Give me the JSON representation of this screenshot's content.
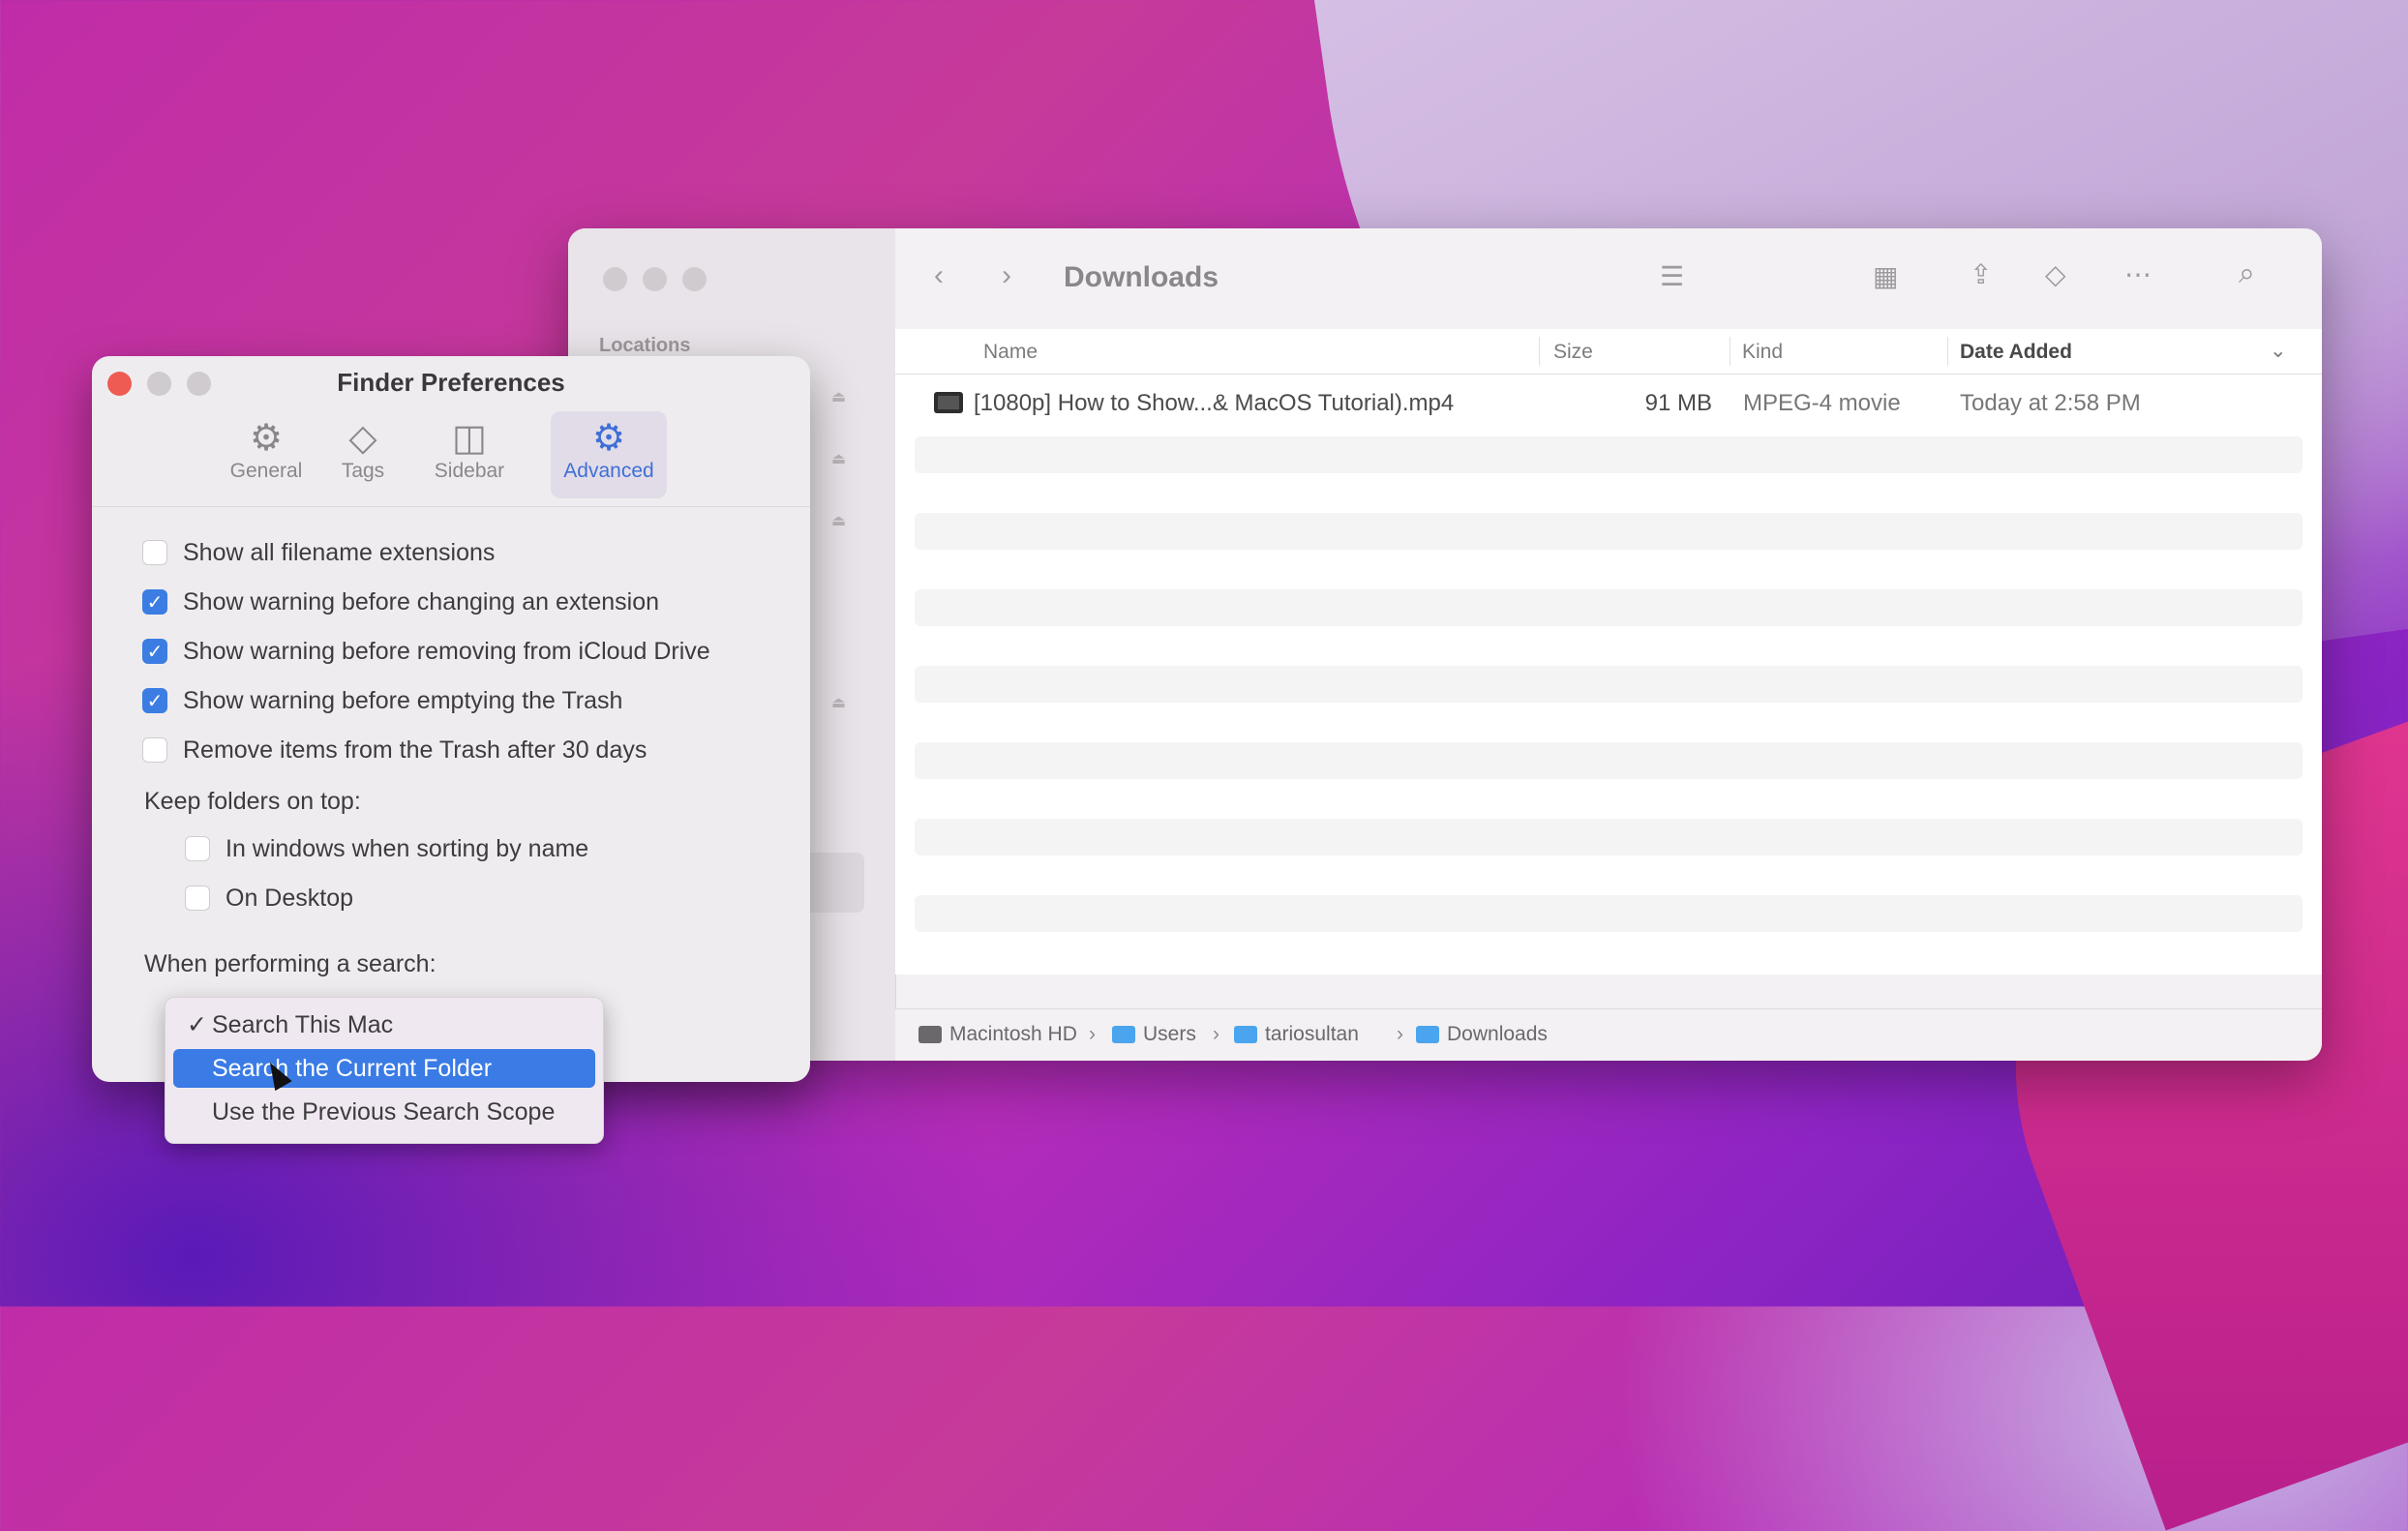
{
  "finder": {
    "title": "Downloads",
    "sidebar_heading": "Locations",
    "columns": {
      "name": "Name",
      "size": "Size",
      "kind": "Kind",
      "date": "Date Added"
    },
    "files": [
      {
        "name": "[1080p] How to Show...& MacOS Tutorial).mp4",
        "size": "91 MB",
        "kind": "MPEG-4 movie",
        "date": "Today at 2:58 PM"
      }
    ],
    "path": [
      "Macintosh HD",
      "Users",
      "tariosultan",
      "Downloads"
    ],
    "path_separator": "›"
  },
  "prefs": {
    "title": "Finder Preferences",
    "tabs": [
      "General",
      "Tags",
      "Sidebar",
      "Advanced"
    ],
    "active_tab": "Advanced",
    "options": [
      {
        "label": "Show all filename extensions",
        "checked": false
      },
      {
        "label": "Show warning before changing an extension",
        "checked": true
      },
      {
        "label": "Show warning before removing from iCloud Drive",
        "checked": true
      },
      {
        "label": "Show warning before emptying the Trash",
        "checked": true
      },
      {
        "label": "Remove items from the Trash after 30 days",
        "checked": false
      }
    ],
    "keep_folders_label": "Keep folders on top:",
    "keep_folders": [
      {
        "label": "In windows when sorting by name",
        "checked": false
      },
      {
        "label": "On Desktop",
        "checked": false
      }
    ],
    "search_label": "When performing a search:"
  },
  "menu": {
    "checkmark": "✓",
    "items": [
      "Search This Mac",
      "Search the Current Folder",
      "Use the Previous Search Scope"
    ],
    "checked_index": 0,
    "highlighted_index": 1
  },
  "colors": {
    "accent": "#3b7de2",
    "close": "#ee5b52"
  }
}
